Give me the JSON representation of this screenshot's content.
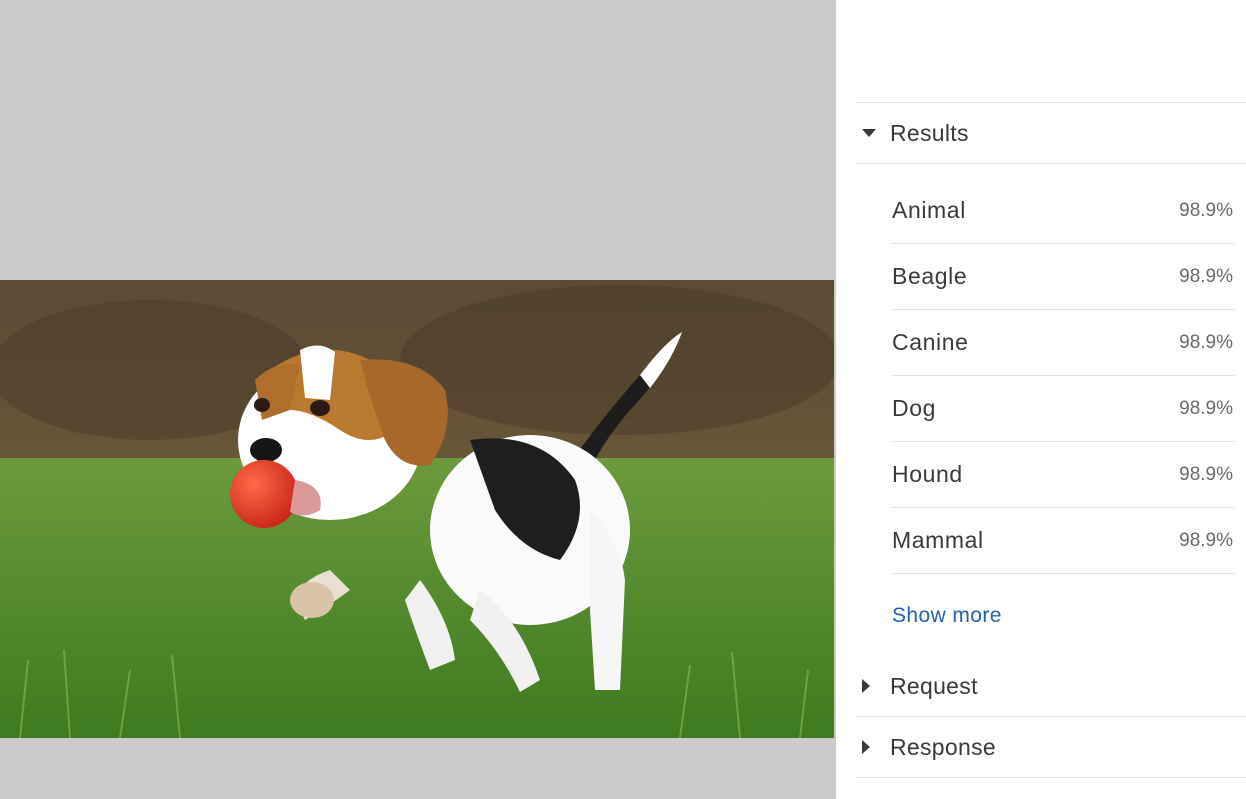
{
  "results_section": {
    "title": "Results",
    "items": [
      {
        "label": "Animal",
        "score": "98.9%"
      },
      {
        "label": "Beagle",
        "score": "98.9%"
      },
      {
        "label": "Canine",
        "score": "98.9%"
      },
      {
        "label": "Dog",
        "score": "98.9%"
      },
      {
        "label": "Hound",
        "score": "98.9%"
      },
      {
        "label": "Mammal",
        "score": "98.9%"
      }
    ],
    "show_more_label": "Show more"
  },
  "request_section": {
    "title": "Request"
  },
  "response_section": {
    "title": "Response"
  },
  "icons": {
    "expanded": "caret-down-icon",
    "collapsed": "caret-right-icon"
  },
  "colors": {
    "canvas_background": "#cbcbcb",
    "link": "#2461ad",
    "divider": "#e1e1e1",
    "text": "#3a3a3a"
  }
}
